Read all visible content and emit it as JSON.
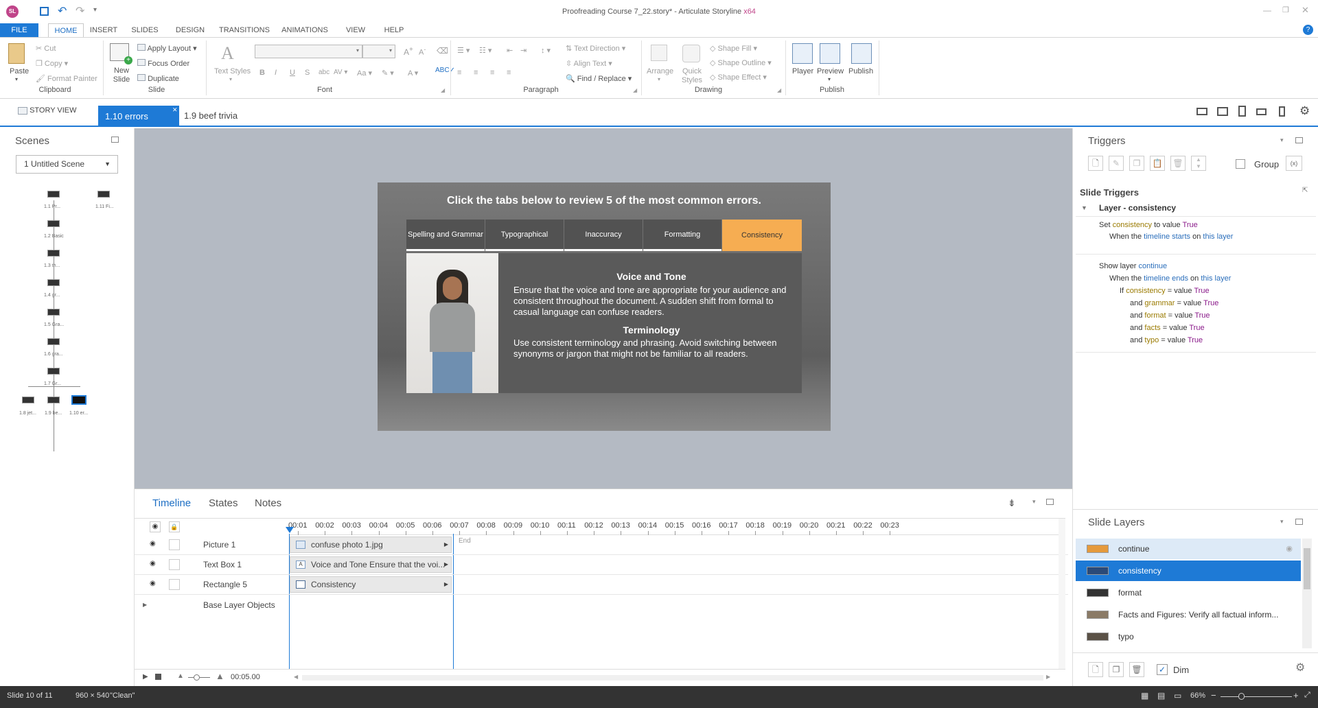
{
  "title": {
    "text": "Proofreading Course 7_22.story* - Articulate Storyline",
    "arch": "x64",
    "logo": "SL"
  },
  "ribbon_tabs": [
    "FILE",
    "HOME",
    "INSERT",
    "SLIDES",
    "DESIGN",
    "TRANSITIONS",
    "ANIMATIONS",
    "VIEW",
    "HELP"
  ],
  "clipboard": {
    "paste": "Paste",
    "cut": "Cut",
    "copy": "Copy",
    "format_painter": "Format Painter",
    "label": "Clipboard"
  },
  "slide_group": {
    "new_slide": "New Slide",
    "apply_layout": "Apply Layout",
    "focus_order": "Focus Order",
    "duplicate": "Duplicate",
    "label": "Slide"
  },
  "font_group": {
    "text_styles": "Text Styles",
    "label": "Font"
  },
  "paragraph": {
    "text_direction": "Text Direction",
    "align_text": "Align Text",
    "find_replace": "Find / Replace",
    "label": "Paragraph"
  },
  "drawing": {
    "arrange": "Arrange",
    "quick_styles": "Quick Styles",
    "shape_fill": "Shape Fill",
    "shape_outline": "Shape Outline",
    "shape_effect": "Shape Effect",
    "label": "Drawing"
  },
  "publish": {
    "player": "Player",
    "preview": "Preview",
    "publish": "Publish",
    "label": "Publish"
  },
  "view_tabs": {
    "story_view": "STORY VIEW",
    "active": "1.10 errors",
    "other": "1.9 beef trivia"
  },
  "scenes": {
    "title": "Scenes",
    "dropdown": "1 Untitled Scene",
    "labels": [
      "1.1 Pr...",
      "1.11 Fi...",
      "1.2 Basic",
      "1.3 th...",
      "1.4 gr...",
      "1.5 Gra...",
      "1.6 gra...",
      "1.7 Gr...",
      "1.8 jet...",
      "1.9 be...",
      "1.10 er..."
    ]
  },
  "slide": {
    "header": "Click the tabs below to review 5 of the most common errors.",
    "tabs": [
      "Spelling and Grammar",
      "Typographical",
      "Inaccuracy",
      "Formatting",
      "Consistency"
    ],
    "h1": "Voice and Tone",
    "p1": "Ensure that the voice and tone are appropriate for your audience and consistent throughout the document. A sudden shift from formal to casual language can confuse readers.",
    "h2": "Terminology",
    "p2": "Use consistent terminology and phrasing. Avoid switching between synonyms or jargon that might not be familiar to all readers.",
    "active_tab_color": "#f6ad52"
  },
  "timeline": {
    "tabs": [
      "Timeline",
      "States",
      "Notes"
    ],
    "ticks": [
      "00:01",
      "00:02",
      "00:03",
      "00:04",
      "00:05",
      "00:06",
      "00:07",
      "00:08",
      "00:09",
      "00:10",
      "00:11",
      "00:12",
      "00:13",
      "00:14",
      "00:15",
      "00:16",
      "00:17",
      "00:18",
      "00:19",
      "00:20",
      "00:21",
      "00:22",
      "00:23"
    ],
    "end_label": "End",
    "duration": "00:05.00",
    "rows": [
      {
        "name": "Picture 1",
        "bar": "confuse photo 1.jpg"
      },
      {
        "name": "Text Box 1",
        "bar": "Voice and Tone Ensure that the voi..."
      },
      {
        "name": "Rectangle 5",
        "bar": "Consistency"
      }
    ],
    "base": "Base Layer Objects"
  },
  "triggers": {
    "title": "Triggers",
    "group": "Group",
    "slide_triggers": "Slide Triggers",
    "layer_header": "Layer - consistency",
    "t1": {
      "set": "Set",
      "var": "consistency",
      "to": "to value",
      "val": "True",
      "when": "When the",
      "event": "timeline starts",
      "on": "on",
      "obj": "this layer"
    },
    "t2": {
      "show": "Show layer",
      "layer": "continue",
      "when": "When the",
      "event": "timeline ends",
      "on": "on",
      "obj": "this layer",
      "if": "If",
      "c1": "consistency",
      "c2": "grammar",
      "c3": "format",
      "c4": "facts",
      "c5": "typo",
      "and": "and",
      "eq": "= value",
      "val": "True"
    }
  },
  "layers": {
    "title": "Slide Layers",
    "items": [
      "continue",
      "consistency",
      "format",
      "Facts and Figures: Verify all factual inform...",
      "typo"
    ],
    "dim": "Dim"
  },
  "status": {
    "slide": "Slide 10 of 11",
    "size": "960 × 540",
    "theme": "\"Clean\"",
    "zoom": "66%"
  }
}
